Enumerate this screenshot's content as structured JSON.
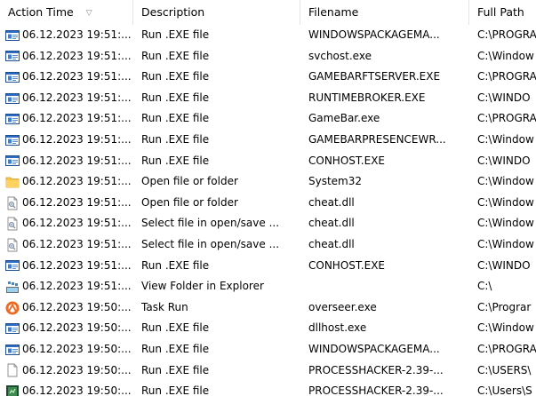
{
  "columns": {
    "time": "Action Time",
    "description": "Description",
    "filename": "Filename",
    "path": "Full Path"
  },
  "rows": [
    {
      "icon": "executable-icon",
      "time": "06.12.2023 19:51:...",
      "description": "Run .EXE file",
      "filename": "WINDOWSPACKAGEMA...",
      "path": "C:\\PROGRA"
    },
    {
      "icon": "executable-icon",
      "time": "06.12.2023 19:51:...",
      "description": "Run .EXE file",
      "filename": "svchost.exe",
      "path": "C:\\Window"
    },
    {
      "icon": "executable-icon",
      "time": "06.12.2023 19:51:...",
      "description": "Run .EXE file",
      "filename": "GAMEBARFTSERVER.EXE",
      "path": "C:\\PROGRA"
    },
    {
      "icon": "executable-icon",
      "time": "06.12.2023 19:51:...",
      "description": "Run .EXE file",
      "filename": "RUNTIMEBROKER.EXE",
      "path": "C:\\WINDO"
    },
    {
      "icon": "executable-icon",
      "time": "06.12.2023 19:51:...",
      "description": "Run .EXE file",
      "filename": "GameBar.exe",
      "path": "C:\\PROGRA"
    },
    {
      "icon": "executable-icon",
      "time": "06.12.2023 19:51:...",
      "description": "Run .EXE file",
      "filename": "GAMEBARPRESENCEWR...",
      "path": "C:\\Window"
    },
    {
      "icon": "executable-icon",
      "time": "06.12.2023 19:51:...",
      "description": "Run .EXE file",
      "filename": "CONHOST.EXE",
      "path": "C:\\WINDO"
    },
    {
      "icon": "folder-icon",
      "time": "06.12.2023 19:51:...",
      "description": "Open file or folder",
      "filename": "System32",
      "path": "C:\\Window"
    },
    {
      "icon": "dll-file-icon",
      "time": "06.12.2023 19:51:...",
      "description": "Open file or folder",
      "filename": "cheat.dll",
      "path": "C:\\Window"
    },
    {
      "icon": "dll-file-icon",
      "time": "06.12.2023 19:51:...",
      "description": "Select file in open/save ...",
      "filename": "cheat.dll",
      "path": "C:\\Window"
    },
    {
      "icon": "dll-file-icon",
      "time": "06.12.2023 19:51:...",
      "description": "Select file in open/save ...",
      "filename": "cheat.dll",
      "path": "C:\\Window"
    },
    {
      "icon": "executable-icon",
      "time": "06.12.2023 19:51:...",
      "description": "Run .EXE file",
      "filename": "CONHOST.EXE",
      "path": "C:\\WINDO"
    },
    {
      "icon": "explorer-icon",
      "time": "06.12.2023 19:51:...",
      "description": "View Folder in Explorer",
      "filename": "",
      "path": "C:\\"
    },
    {
      "icon": "task-icon",
      "time": "06.12.2023 19:50:...",
      "description": "Task Run",
      "filename": "overseer.exe",
      "path": "C:\\Prograr"
    },
    {
      "icon": "executable-icon",
      "time": "06.12.2023 19:50:...",
      "description": "Run .EXE file",
      "filename": "dllhost.exe",
      "path": "C:\\Window"
    },
    {
      "icon": "executable-icon",
      "time": "06.12.2023 19:50:...",
      "description": "Run .EXE file",
      "filename": "WINDOWSPACKAGEMA...",
      "path": "C:\\PROGRA"
    },
    {
      "icon": "blank-file-icon",
      "time": "06.12.2023 19:50:...",
      "description": "Run .EXE file",
      "filename": "PROCESSHACKER-2.39-...",
      "path": "C:\\USERS\\"
    },
    {
      "icon": "app-icon",
      "time": "06.12.2023 19:50:...",
      "description": "Run .EXE file",
      "filename": "PROCESSHACKER-2.39-...",
      "path": "C:\\Users\\S"
    }
  ]
}
